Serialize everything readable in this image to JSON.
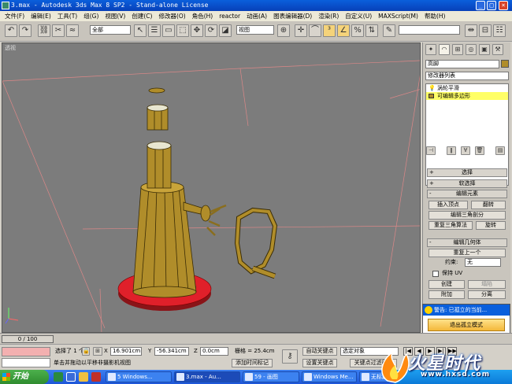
{
  "window": {
    "title": "3.max - Autodesk 3ds Max 8 SP2 - Stand-alone License",
    "min": "_",
    "max": "□",
    "close": "×"
  },
  "menu": [
    "文件(F)",
    "编辑(E)",
    "工具(T)",
    "组(G)",
    "视图(V)",
    "创建(C)",
    "修改器(O)",
    "角色(H)",
    "reactor",
    "动画(A)",
    "图表编辑器(D)",
    "渲染(R)",
    "自定义(U)",
    "MAXScript(M)",
    "帮助(H)"
  ],
  "toolbar": {
    "selection_filter": "全部",
    "coord_system": "视图",
    "named_selection": ""
  },
  "viewport": {
    "label": "透视"
  },
  "panel": {
    "object_name": "高脚",
    "modifier_list": "修改器列表",
    "stack": [
      "涡轮平滑",
      "可编辑多边形"
    ],
    "rollouts": [
      {
        "sign": "+",
        "label": "选择"
      },
      {
        "sign": "+",
        "label": "软选择"
      },
      {
        "sign": "-",
        "label": "编辑元素"
      }
    ],
    "edit_element": {
      "insert_vertex": "插入顶点",
      "flip": "翻转",
      "edit_tri": "编辑三角剖分",
      "retri": "重复三角算法",
      "turn": "旋转"
    },
    "edit_geometry": {
      "title": "编辑几何体",
      "repeat_last": "重复上一个",
      "constraint_label": "约束:",
      "constraint_value": "无",
      "preserve_uv": "保持 UV",
      "create": "创建",
      "collapse": "塌陷",
      "attach": "附加",
      "detach": "分离"
    }
  },
  "warning": {
    "title": "警告: 已孤立的当前...",
    "exit_button": "退出孤立模式"
  },
  "timeline": {
    "frame": "0 / 100"
  },
  "status": {
    "selected": "选择了 1 个",
    "x_label": "X",
    "x": "16.901cm",
    "y_label": "Y",
    "y": "-56.341cm",
    "z_label": "Z",
    "z": "0.0cm",
    "grid": "栅格 = 25.4cm",
    "auto_key": "自动关键点",
    "set_key": "设置关键点",
    "selection_set": "选定对象",
    "key_filters": "关键点过滤器...",
    "prompt": "单击并拖动以平移非摄影机视图",
    "add_time_tag": "添加时间标记"
  },
  "taskbar": {
    "start": "开始",
    "tasks": [
      "5 Windows...",
      "3.max - Au...",
      "59 - 画图",
      "Windows Me...",
      "无标题 - 记..."
    ]
  },
  "watermark": {
    "brand": "火星时代",
    "url": "www.hxsd.com"
  },
  "colors": {
    "title_blue": "#0a5fdc",
    "viewport_gray": "#7c7c7c",
    "model_gold": "#b08d2a",
    "model_red": "#e0202a",
    "stack_highlight": "#ffff66"
  }
}
